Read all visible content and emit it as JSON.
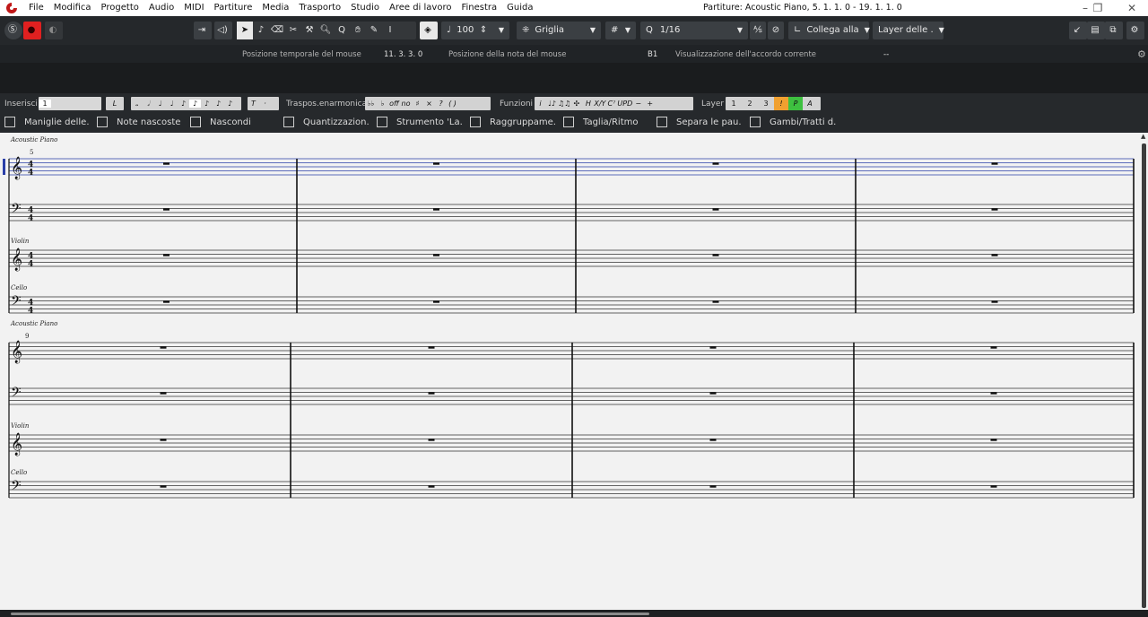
{
  "menu": [
    "File",
    "Modifica",
    "Progetto",
    "Audio",
    "MIDI",
    "Partiture",
    "Media",
    "Trasporto",
    "Studio",
    "Aree di lavoro",
    "Finestra",
    "Guida"
  ],
  "window_title": "Partiture: Acoustic Piano, 5. 1. 1.  0 - 19. 1. 1.  0",
  "toolbar": {
    "velocity_value": "100",
    "snap_mode": "Griglia",
    "quantize_value": "1/16",
    "link_mode": "Collega alla",
    "layer_mode": "Layer delle ."
  },
  "info": {
    "mouse_time_label": "Posizione temporale del mouse",
    "mouse_time_value": "11. 3. 3.   0",
    "mouse_note_label": "Posizione della nota del mouse",
    "mouse_note_value": "B1",
    "chord_label": "Visualizzazione dell'accordo corrente",
    "chord_value": "--"
  },
  "symbols": {
    "insert_label": "Inserisci",
    "insert_value": "1",
    "l_button": "L",
    "t_button": "T",
    "dot_button": "·",
    "enharmonic_label": "Traspos.enarmonica",
    "enharmonic_items": [
      "♭♭",
      "♭",
      "off",
      "no",
      "♯",
      "×",
      "?",
      "( )"
    ],
    "functions_label": "Funzioni",
    "function_items": [
      "i",
      "♩♪",
      "♫♫",
      "✣",
      "H",
      "X/Y",
      "C⁷",
      "UPD",
      "−",
      "+"
    ],
    "layer_label": "Layer",
    "layer_items": [
      "1",
      "2",
      "3",
      "!",
      "P",
      "A"
    ]
  },
  "checkboxes": [
    "Maniglie delle.",
    "Note nascoste",
    "Nascondi",
    "Quantizzazion.",
    "Strumento 'La.",
    "Raggruppame.",
    "Taglia/Ritmo",
    "Separa le pau.",
    "Gambi/Tratti d."
  ],
  "score": {
    "systems": [
      {
        "instrument_top": "Acoustic Piano",
        "bar_number": "5",
        "time_signature": "4/4",
        "staff_labels": [
          "",
          "",
          "Violin",
          "Cello"
        ]
      },
      {
        "instrument_top": "Acoustic Piano",
        "bar_number": "9",
        "time_signature": "",
        "staff_labels": [
          "",
          "",
          "Violin",
          "Cello"
        ]
      }
    ],
    "clefs": [
      "treble",
      "bass",
      "treble",
      "bass"
    ]
  },
  "colors": {
    "accent_red": "#e02020",
    "selected_staff": "#2a3fa8",
    "layer_orange": "#f0a030",
    "layer_green": "#3ec040"
  }
}
